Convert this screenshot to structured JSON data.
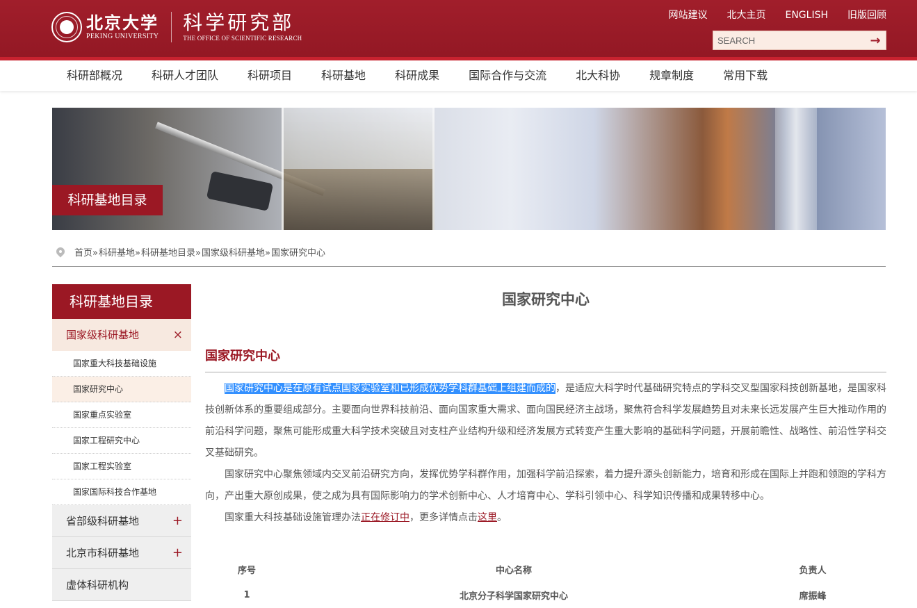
{
  "header": {
    "pku_name_cn": "北京大学",
    "pku_name_en": "PEKING UNIVERSITY",
    "dept_name_cn": "科学研究部",
    "dept_name_en": "THE OFFICE OF SCIENTIFIC RESEARCH",
    "top_links": [
      "网站建议",
      "北大主页",
      "ENGLISH",
      "旧版回顾"
    ],
    "search_placeholder": "SEARCH",
    "search_icon": "→",
    "brand_color": "#9b1824"
  },
  "nav": {
    "items": [
      "科研部概况",
      "科研人才团队",
      "科研项目",
      "科研基地",
      "科研成果",
      "国际合作与交流",
      "北大科协",
      "规章制度",
      "常用下载"
    ]
  },
  "banner": {
    "label": "科研基地目录"
  },
  "breadcrumb": {
    "items": [
      "首页",
      "科研基地",
      "科研基地目录",
      "国家级科研基地",
      "国家研究中心"
    ],
    "separator": "»"
  },
  "sidebar": {
    "title": "科研基地目录",
    "expanded_group": {
      "label": "国家级科研基地",
      "control": "×"
    },
    "sub_items": [
      "国家重大科技基础设施",
      "国家研究中心",
      "国家重点实验室",
      "国家工程研究中心",
      "国家工程实验室",
      "国家国际科技合作基地"
    ],
    "active_sub_index": 1,
    "collapsed_groups": [
      {
        "label": "省部级科研基地",
        "control": "+"
      },
      {
        "label": "北京市科研基地",
        "control": "+"
      },
      {
        "label": "虚体科研机构",
        "control": ""
      }
    ]
  },
  "content": {
    "page_title": "国家研究中心",
    "section_title": "国家研究中心",
    "para1_highlight": "国家研究中心是在原有试点国家实验室和已形成优势学科群基础上组建而成的",
    "para1_rest": "，是适应大科学时代基础研究特点的学科交叉型国家科技创新基地，是国家科技创新体系的重要组成部分。主要面向世界科技前沿、面向国家重大需求、面向国民经济主战场，聚焦符合科学发展趋势且对未来长远发展产生巨大推动作用的前沿科学问题，聚焦可能形成重大科学技术突破且对支柱产业结构升级和经济发展方式转变产生重大影响的基础科学问题，开展前瞻性、战略性、前沿性学科交叉基础研究。",
    "para2": "国家研究中心聚焦领域内交叉前沿研究方向，发挥优势学科群作用，加强科学前沿探索，着力提升源头创新能力，培育和形成在国际上并跑和领跑的学科方向，产出重大原创成果，使之成为具有国际影响力的学术创新中心、人才培育中心、学科引领中心、科学知识传播和成果转移中心。",
    "para3_pre": "国家重大科技基础设施管理办法",
    "para3_link1": "正在修订中",
    "para3_mid": "，更多详情点击",
    "para3_link2": "这里",
    "para3_end": "。"
  },
  "table": {
    "headers": [
      "序号",
      "中心名称",
      "负责人"
    ],
    "rows": [
      [
        "1",
        "北京分子科学国家研究中心",
        "席振峰"
      ]
    ]
  }
}
